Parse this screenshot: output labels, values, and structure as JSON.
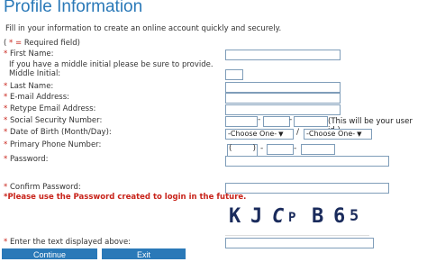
{
  "title": "Profile Information",
  "intro": "Fill in your information to create an online account quickly and securely.",
  "required_note": {
    "open": "(",
    "star": "* = ",
    "text": "Required field)"
  },
  "fields": {
    "first_name": {
      "star": "*",
      "label": "First Name:"
    },
    "middle_note": "If you have a middle initial please be sure to provide.",
    "middle_initial": {
      "label": "Middle Initial:"
    },
    "last_name": {
      "star": "*",
      "label": "Last Name:"
    },
    "email": {
      "star": "*",
      "label": "E-mail Address:"
    },
    "retype_email": {
      "star": "*",
      "label": "Retype Email Address:"
    },
    "ssn": {
      "star": "*",
      "label": "Social Security Number:",
      "sep": "-",
      "hint": "(This will be your user id.)"
    },
    "dob": {
      "star": "*",
      "label": "Date of Birth (Month/Day):",
      "month": "-Choose One-",
      "day": "-Choose One-",
      "sep": "/"
    },
    "phone": {
      "star": "*",
      "label": "Primary Phone Number:",
      "open": "(",
      "close": ")",
      "sep": "-"
    },
    "password": {
      "star": "*",
      "label": "Password:"
    },
    "confirm_password": {
      "star": "*",
      "label": "Confirm Password:"
    }
  },
  "password_warning_star": "*",
  "password_warning": "Please use the Password created to login in the future.",
  "captcha": {
    "chars": [
      "K",
      "J",
      "C",
      "P",
      "B",
      "6",
      "5"
    ]
  },
  "captcha_field": {
    "star": "*",
    "label": "Enter the text displayed above:"
  },
  "buttons": {
    "continue": "Continue",
    "exit": "Exit"
  },
  "colors": {
    "accent": "#2a79b8",
    "required": "#c8231a"
  }
}
